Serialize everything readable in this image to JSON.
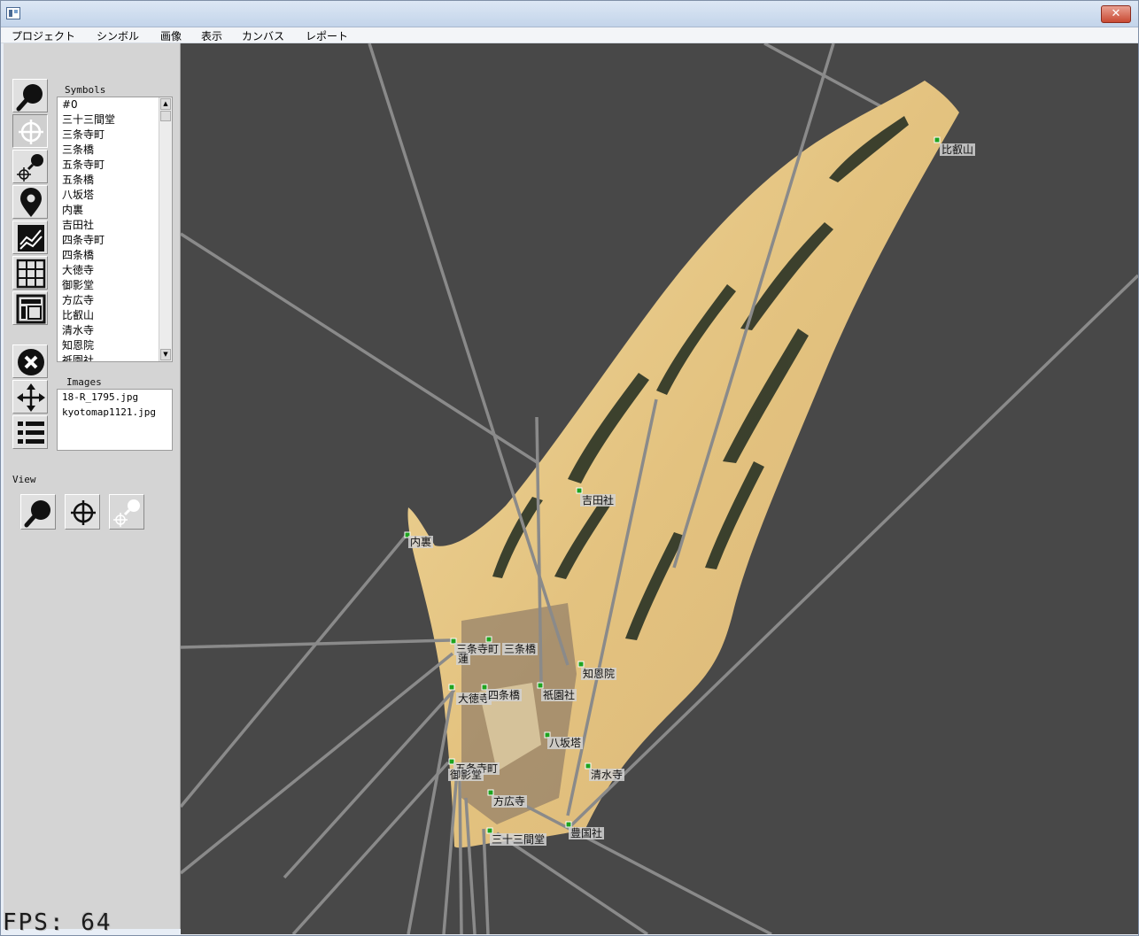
{
  "window": {
    "close_label": "✕"
  },
  "menu": [
    "プロジェクト",
    "シンボル",
    "画像",
    "表示",
    "カンバス",
    "レポート"
  ],
  "tools": [
    {
      "icon": "zoom-icon"
    },
    {
      "icon": "crosshair-icon"
    },
    {
      "icon": "zoom-crosshair-icon"
    },
    {
      "icon": "map-pin-icon"
    },
    {
      "icon": "chart-icon"
    },
    {
      "icon": "grid-icon"
    },
    {
      "icon": "layout-icon"
    },
    {
      "icon": "delete-icon"
    },
    {
      "icon": "move-icon"
    },
    {
      "icon": "list-icon"
    }
  ],
  "symbols": {
    "label": "Symbols",
    "items": [
      "#0",
      "三十三間堂",
      "三条寺町",
      "三条橋",
      "五条寺町",
      "五条橋",
      "八坂塔",
      "内裏",
      "吉田社",
      "四条寺町",
      "四条橋",
      "大徳寺",
      "御影堂",
      "方広寺",
      "比叡山",
      "清水寺",
      "知恩院",
      "祇園社"
    ]
  },
  "images": {
    "label": "Images",
    "items": [
      "18-R_1795.jpg",
      "kyotomap1121.jpg"
    ]
  },
  "view": {
    "label": "View"
  },
  "fps": "FPS: 64",
  "map_labels": [
    "比叡山",
    "吉田社",
    "内裏",
    "三条寺町",
    "三条橋",
    "蓮",
    "大徳寺",
    "四条橋",
    "祇園社",
    "知恩院",
    "八坂塔",
    "五条寺町",
    "御影堂",
    "清水寺",
    "方広寺",
    "豊国社",
    "三十三間堂"
  ],
  "colors": {
    "canvas_bg": "#484848",
    "panel_bg": "#d4d4d4",
    "ray": "#8a8a8a",
    "marker": "#1fa31f",
    "texture_base": "#e8c98a"
  }
}
